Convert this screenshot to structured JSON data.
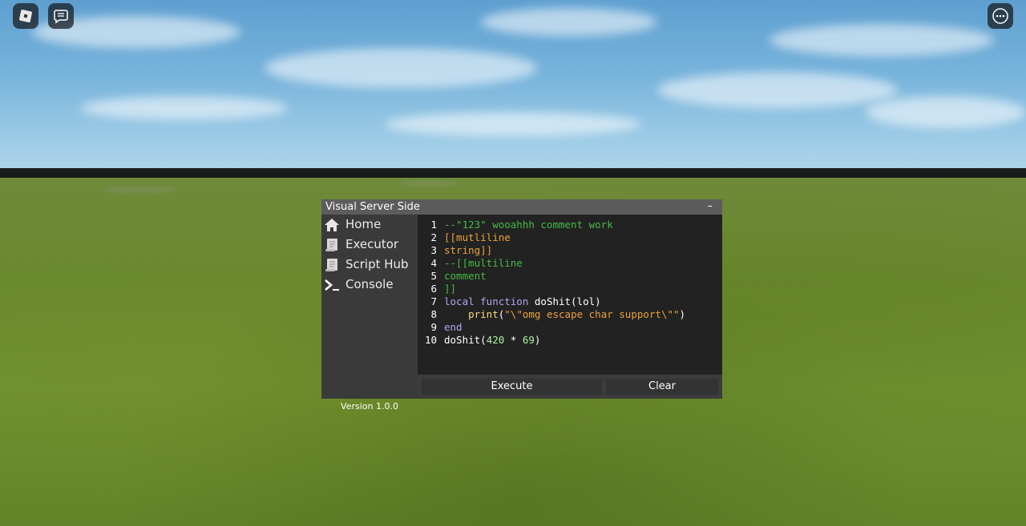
{
  "window": {
    "title": "Visual Server Side",
    "minimize_label": "–"
  },
  "sidebar": {
    "items": [
      {
        "label": "Home",
        "icon": "home-icon"
      },
      {
        "label": "Executor",
        "icon": "scroll-icon"
      },
      {
        "label": "Script Hub",
        "icon": "scroll-icon"
      },
      {
        "label": "Console",
        "icon": "terminal-icon"
      }
    ],
    "version": "Version 1.0.0"
  },
  "editor": {
    "lines": [
      {
        "n": "1",
        "tokens": [
          [
            "comment",
            "--\"123\" wooahhh comment work"
          ]
        ]
      },
      {
        "n": "2",
        "tokens": [
          [
            "string",
            "[[mutliline"
          ]
        ]
      },
      {
        "n": "3",
        "tokens": [
          [
            "string",
            "string]]"
          ]
        ]
      },
      {
        "n": "4",
        "tokens": [
          [
            "comment",
            "--[[multiline"
          ]
        ]
      },
      {
        "n": "5",
        "tokens": [
          [
            "comment",
            "comment"
          ]
        ]
      },
      {
        "n": "6",
        "tokens": [
          [
            "comment",
            "]]"
          ]
        ]
      },
      {
        "n": "7",
        "tokens": [
          [
            "key",
            "local function "
          ],
          [
            "plain",
            "doShit(lol)"
          ]
        ]
      },
      {
        "n": "8",
        "tokens": [
          [
            "plain",
            "    "
          ],
          [
            "builtin",
            "print"
          ],
          [
            "plain",
            "("
          ],
          [
            "string",
            "\"\\\"omg escape char support\\\"\""
          ],
          [
            "plain",
            ")"
          ]
        ]
      },
      {
        "n": "9",
        "tokens": [
          [
            "key",
            "end"
          ]
        ]
      },
      {
        "n": "10",
        "tokens": [
          [
            "plain",
            "doShit("
          ],
          [
            "num",
            "420"
          ],
          [
            "plain",
            " * "
          ],
          [
            "num",
            "69"
          ],
          [
            "plain",
            ")"
          ]
        ]
      }
    ]
  },
  "buttons": {
    "execute": "Execute",
    "clear": "Clear"
  },
  "colors": {
    "comment": "#47b947",
    "string": "#eaa33b",
    "keyword": "#b7a2f0",
    "builtin": "#f5d87a",
    "number": "#aef0a2"
  }
}
